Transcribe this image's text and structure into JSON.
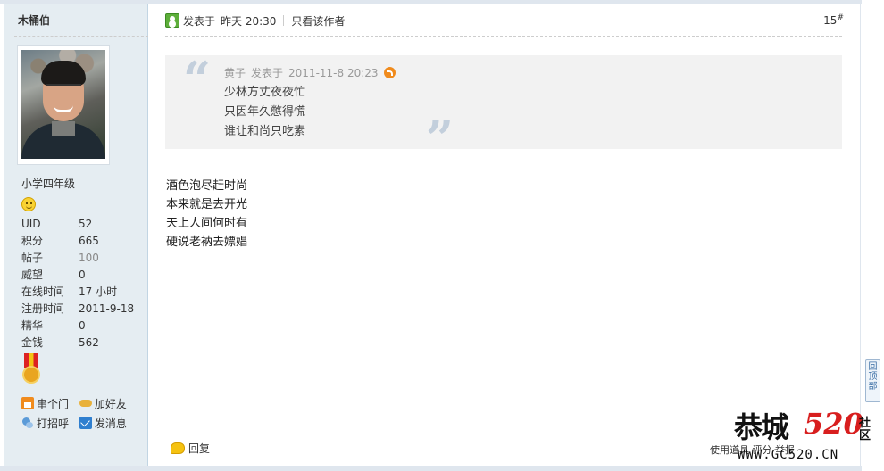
{
  "user": {
    "name": "木桶伯",
    "rank": "小学四年级",
    "stats": [
      {
        "key": "UID",
        "value": "52"
      },
      {
        "key": "积分",
        "value": "665"
      },
      {
        "key": "帖子",
        "value": "100"
      },
      {
        "key": "威望",
        "value": "0"
      },
      {
        "key": "在线时间",
        "value": "17 小时"
      },
      {
        "key": "注册时间",
        "value": "2011-9-18"
      },
      {
        "key": "精华",
        "value": "0"
      },
      {
        "key": "金钱",
        "value": "562"
      }
    ],
    "actions": {
      "home": "串个门",
      "add_friend": "加好友",
      "greet": "打招呼",
      "message": "发消息"
    }
  },
  "post": {
    "posted_label": "发表于",
    "posted_time": "昨天 20:30",
    "author_only": "只看该作者",
    "floor": "15",
    "floor_sup": "#",
    "quote": {
      "author": "黄子",
      "posted_label": "发表于",
      "time": "2011-11-8 20:23",
      "lines": [
        "少林方丈夜夜忙",
        "只因年久憋得慌",
        "谁让和尚只吃素"
      ]
    },
    "body_lines": [
      "酒色泡尽赶时尚",
      "本来就是去开光",
      "天上人间何时有",
      "硬说老衲去嫖娼"
    ],
    "reply_label": "回复",
    "tools_label": "使用道具 评分 举报"
  },
  "back_to_top": "回顶部",
  "watermark": {
    "text": "恭城",
    "number": "520",
    "suffix": "社区",
    "url": "WWW.GC520.CN"
  },
  "colors": {
    "sidebar_bg": "#e5edf2",
    "quote_bg": "#f2f2f2",
    "watermark_red": "#d81e1e"
  }
}
